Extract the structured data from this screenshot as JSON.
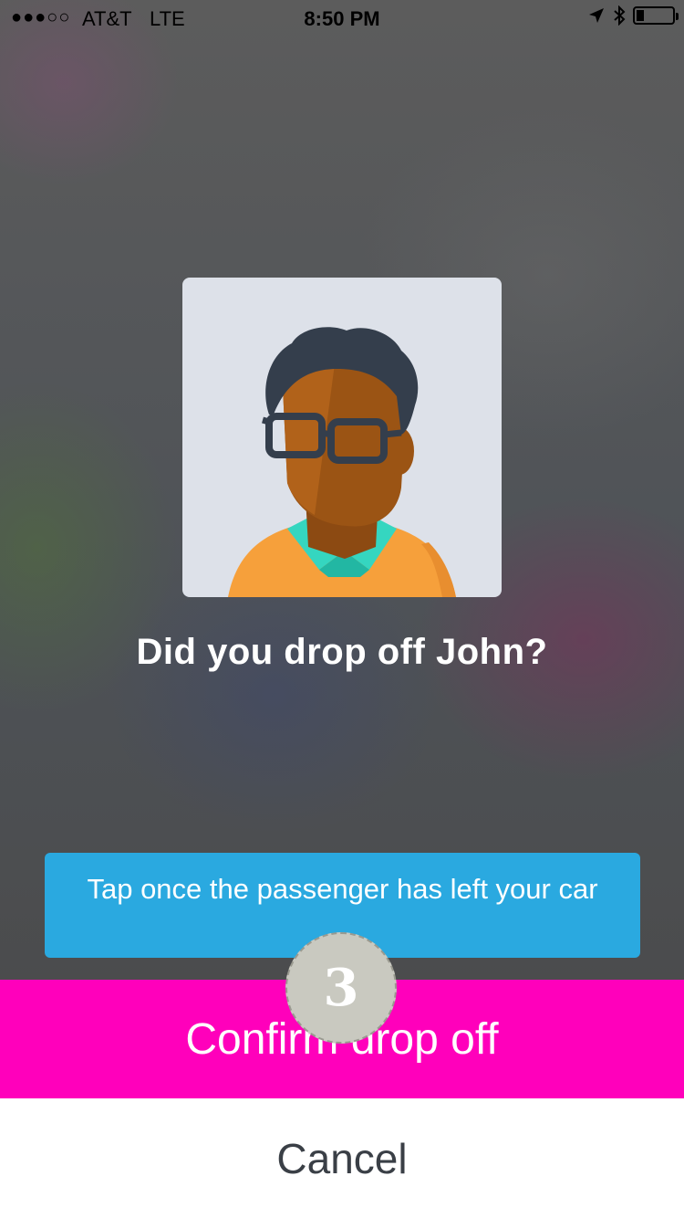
{
  "status_bar": {
    "signal": "●●●○○",
    "carrier": "AT&T",
    "network": "LTE",
    "time": "8:50 PM",
    "icons": [
      "location-arrow-icon",
      "bluetooth-icon",
      "battery-icon"
    ]
  },
  "dialog": {
    "avatar": "passenger-avatar",
    "question": "Did you drop off John?",
    "hint": "Tap once the passenger has left your car"
  },
  "actions": {
    "confirm_label": "Confirm drop off",
    "cancel_label": "Cancel"
  },
  "overlay": {
    "step_number": "3"
  },
  "colors": {
    "confirm": "#ff00bb",
    "hint": "#2aa9e0",
    "card": "#dde1e9"
  }
}
